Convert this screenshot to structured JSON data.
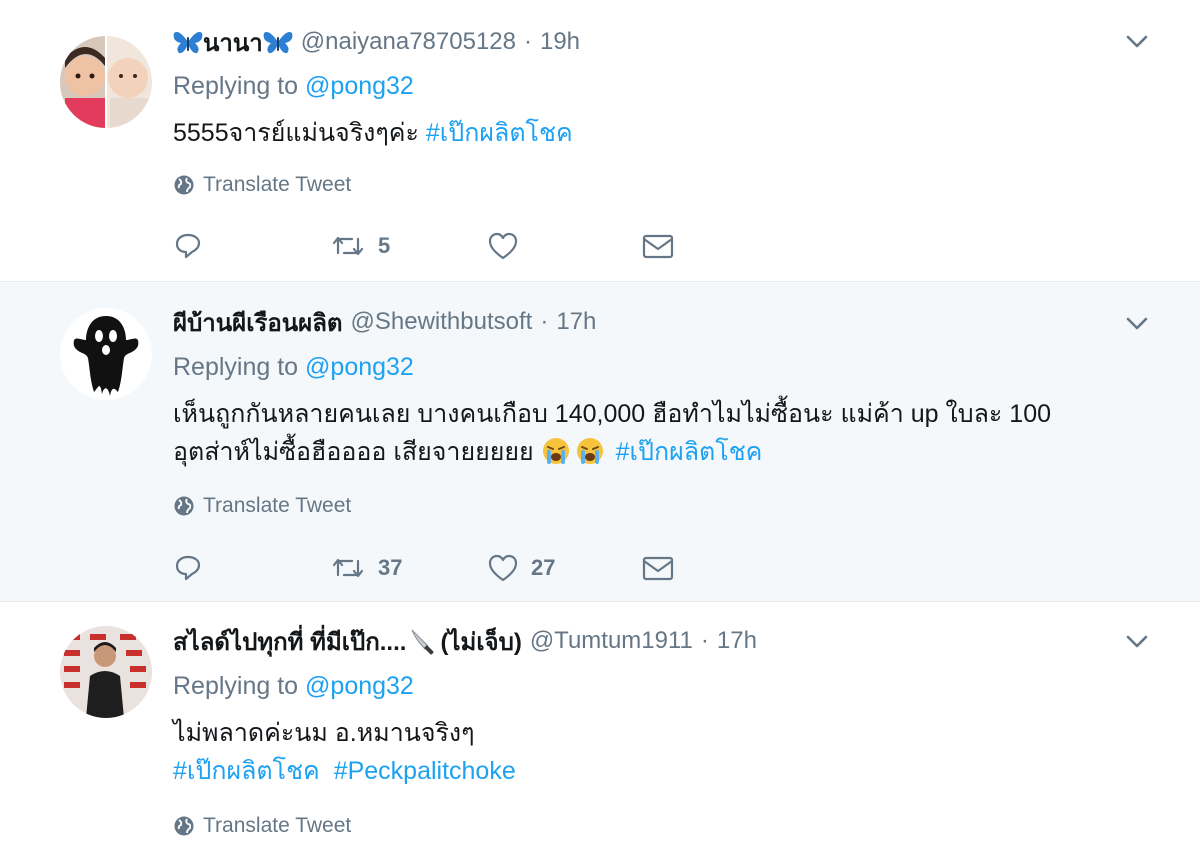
{
  "tweets": [
    {
      "fullname": "นานา",
      "username": "@naiyana78705128",
      "separator": "·",
      "time": "19h",
      "reply_prefix": "Replying to",
      "reply_to": "@pong32",
      "text_line1": "5555จารย์แม่นจริงๆค่ะ",
      "hashtag1": "#เป๊กผลิตโชค",
      "translate_label": "Translate Tweet",
      "retweets": "5",
      "likes": ""
    },
    {
      "fullname": "ผีบ้านผีเรือนผลิต",
      "username": "@Shewithbutsoft",
      "separator": "·",
      "time": "17h",
      "reply_prefix": "Replying to",
      "reply_to": "@pong32",
      "text_line1": "เห็นถูกกันหลายคนเลย บางคนเกือบ 140,000 ฮือทำไมไม่ซื้อนะ แม่ค้า up ใบละ 100",
      "text_line2": "อุตส่าห์ไม่ซื้อฮืออออ เสียจายยยยย",
      "hashtag1": "#เป๊กผลิตโชค",
      "translate_label": "Translate Tweet",
      "retweets": "37",
      "likes": "27"
    },
    {
      "fullname_part1": "สไลด์ไปทุกที่ ที่มีเป๊ก....",
      "fullname_part2": "(ไม่เจ็บ)",
      "username": "@Tumtum1911",
      "separator": "·",
      "time": "17h",
      "reply_prefix": "Replying to",
      "reply_to": "@pong32",
      "text_line1": "ไม่พลาดค่ะนม  อ.หมานจริงๆ",
      "hashtag1": "#เป๊กผลิตโชค",
      "hashtag2": "#Peckpalitchoke",
      "translate_label": "Translate Tweet"
    }
  ],
  "icons": {
    "reply": "reply-icon",
    "retweet": "retweet-icon",
    "like": "heart-icon",
    "message": "envelope-icon",
    "globe": "globe-icon",
    "caret": "chevron-down-icon"
  },
  "colors": {
    "link": "#1da1f2",
    "muted": "#657786",
    "text": "#14171a",
    "highlight_bg": "#f5f8fa",
    "divider": "#e6ecf0"
  }
}
